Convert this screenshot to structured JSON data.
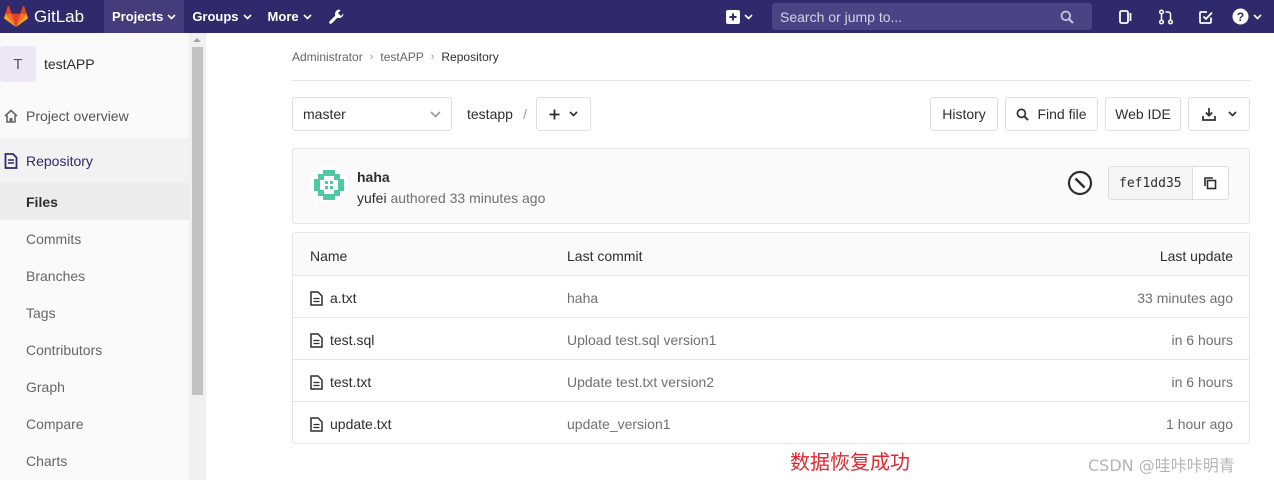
{
  "navbar": {
    "brand": "GitLab",
    "menus": [
      "Projects",
      "Groups",
      "More"
    ],
    "search_placeholder": "Search or jump to...",
    "bg_color": "#2f2a6b"
  },
  "sidebar": {
    "avatar_letter": "T",
    "project_name": "testAPP",
    "overview": "Project overview",
    "repository": "Repository",
    "items": [
      "Files",
      "Commits",
      "Branches",
      "Tags",
      "Contributors",
      "Graph",
      "Compare",
      "Charts"
    ]
  },
  "breadcrumb": [
    "Administrator",
    "testAPP",
    "Repository"
  ],
  "toolbar": {
    "branch": "master",
    "path": "testapp",
    "path_sep": "/",
    "history": "History",
    "find_file": "Find file",
    "web_ide": "Web IDE"
  },
  "last_commit": {
    "title": "haha",
    "author": "yufei",
    "meta": "authored 33 minutes ago",
    "sha": "fef1dd35"
  },
  "tree": {
    "headers": [
      "Name",
      "Last commit",
      "Last update"
    ],
    "rows": [
      {
        "name": "a.txt",
        "commit": "haha",
        "updated": "33 minutes ago"
      },
      {
        "name": "test.sql",
        "commit": "Upload test.sql version1",
        "updated": "in 6 hours"
      },
      {
        "name": "test.txt",
        "commit": "Update test.txt version2",
        "updated": "in 6 hours"
      },
      {
        "name": "update.txt",
        "commit": "update_version1",
        "updated": "1 hour ago"
      }
    ]
  },
  "annotation": "数据恢复成功",
  "watermark": "CSDN @哇咔咔明青"
}
